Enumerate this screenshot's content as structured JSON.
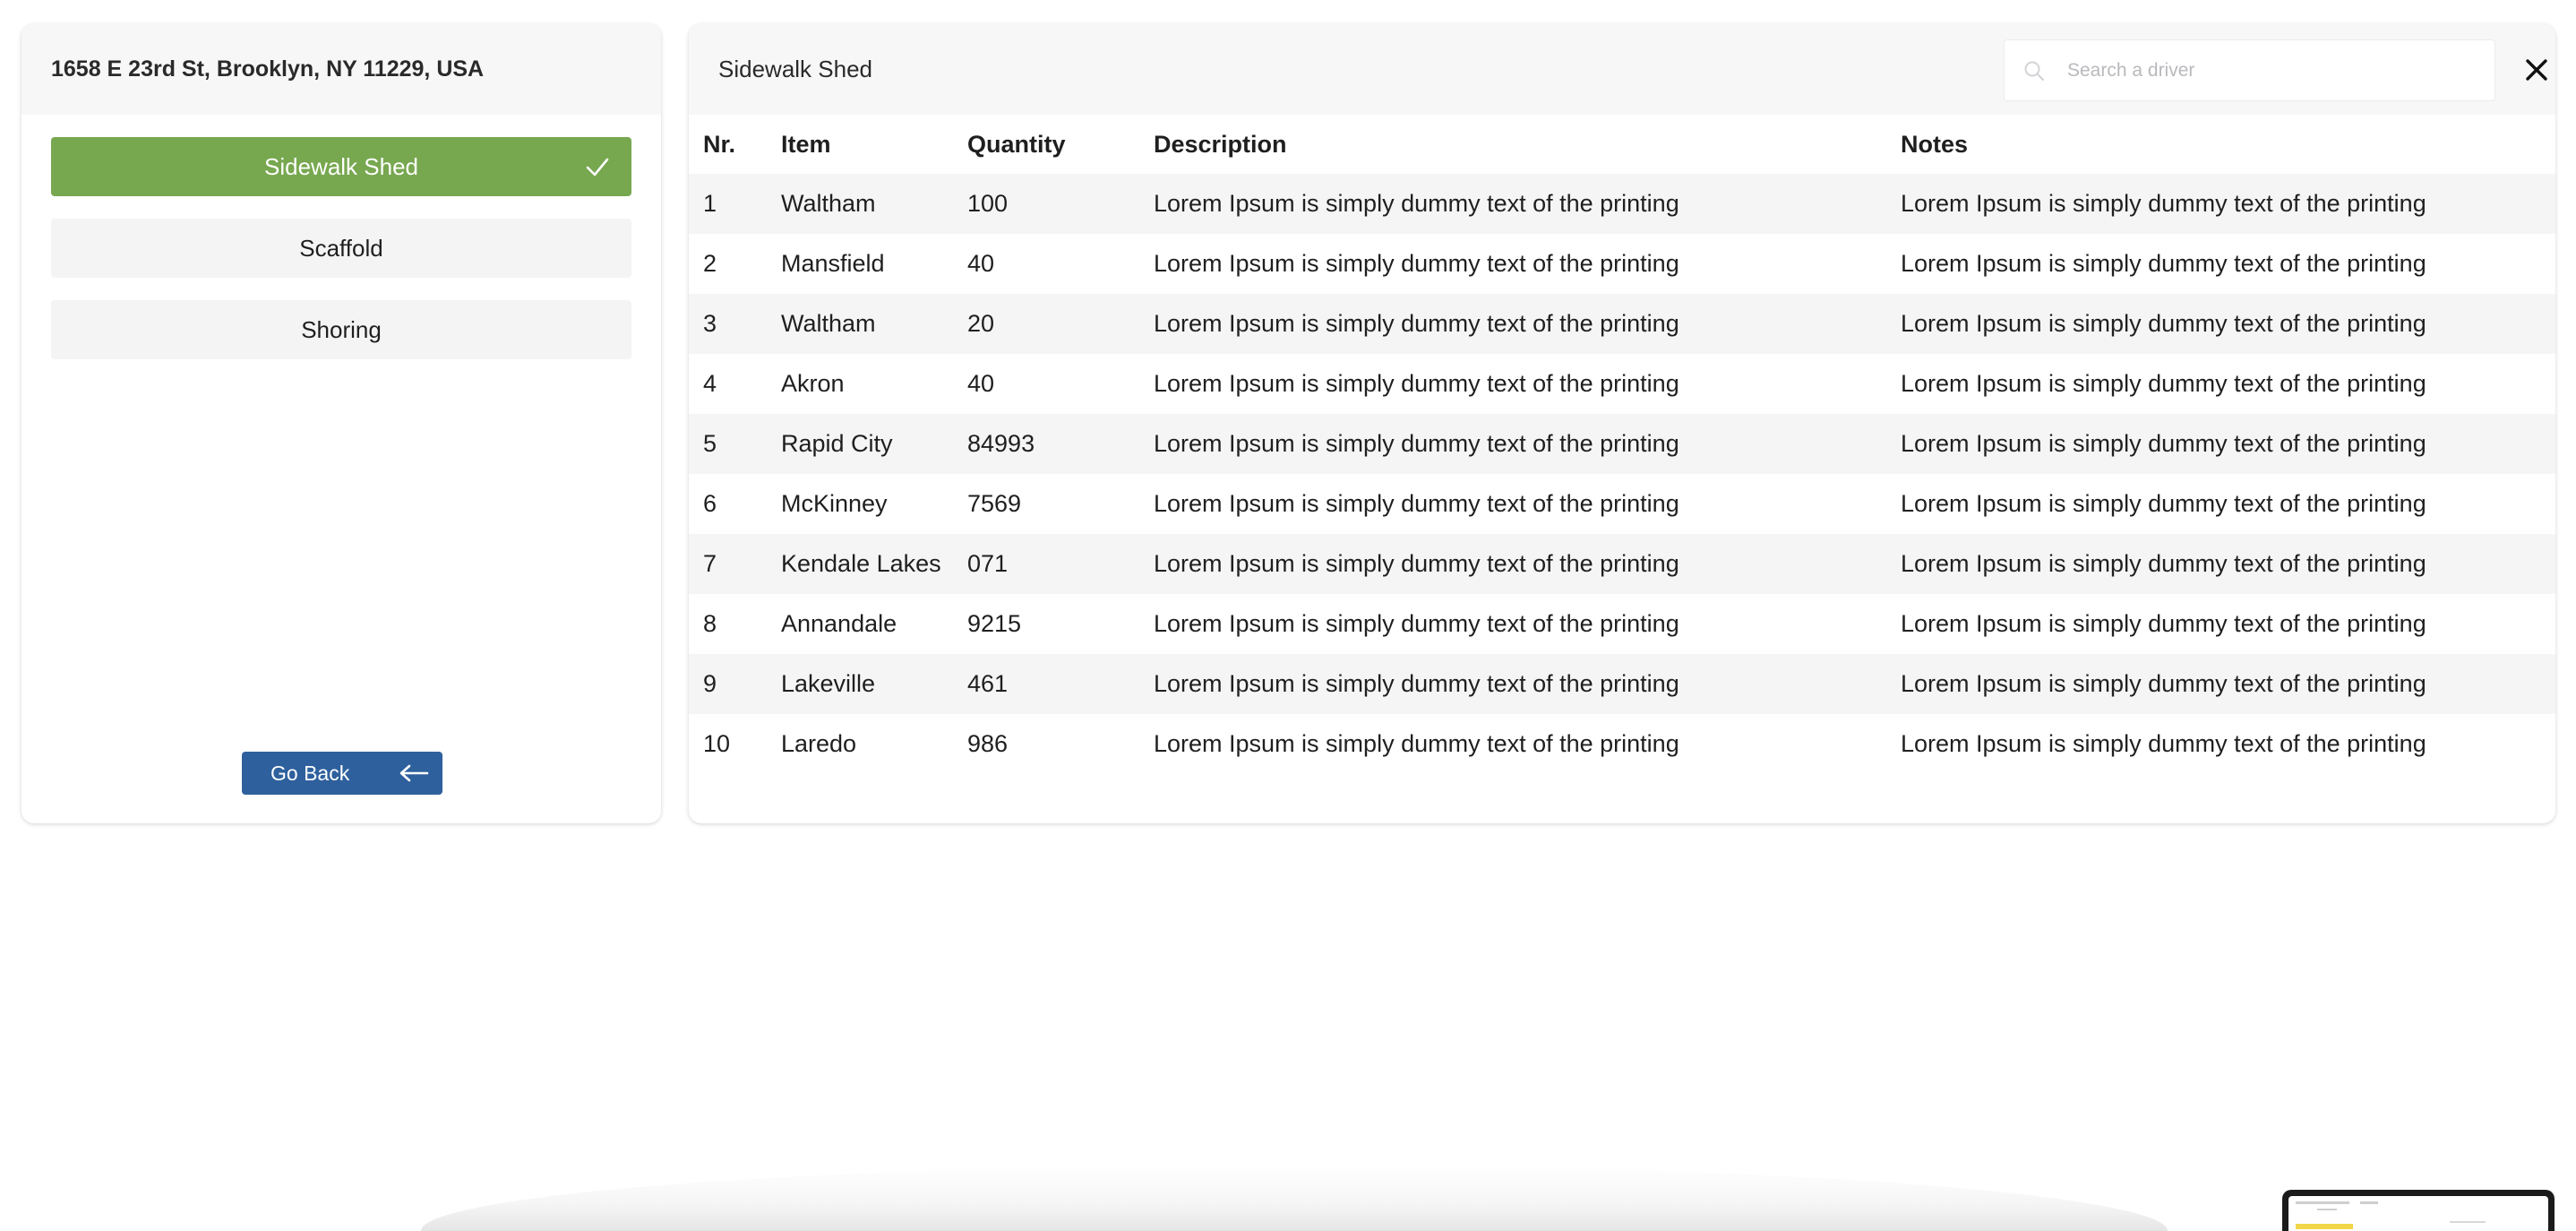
{
  "left_panel": {
    "address": "1658 E 23rd St, Brooklyn, NY 11229, USA",
    "options": [
      {
        "label": "Sidewalk Shed",
        "selected": true
      },
      {
        "label": "Scaffold",
        "selected": false
      },
      {
        "label": "Shoring",
        "selected": false
      }
    ],
    "go_back_label": "Go Back"
  },
  "right_panel": {
    "title": "Sidewalk Shed",
    "search_placeholder": "Search a driver",
    "table": {
      "headers": [
        "Nr.",
        "Item",
        "Quantity",
        "Description",
        "Notes"
      ],
      "rows": [
        [
          "1",
          "Waltham",
          "100",
          "Lorem Ipsum is simply dummy text of the printing",
          "Lorem Ipsum is simply dummy text of the printing"
        ],
        [
          "2",
          "Mansfield",
          "40",
          "Lorem Ipsum is simply dummy text of the printing",
          "Lorem Ipsum is simply dummy text of the printing"
        ],
        [
          "3",
          "Waltham",
          "20",
          "Lorem Ipsum is simply dummy text of the printing",
          "Lorem Ipsum is simply dummy text of the printing"
        ],
        [
          "4",
          "Akron",
          "40",
          "Lorem Ipsum is simply dummy text of the printing",
          "Lorem Ipsum is simply dummy text of the printing"
        ],
        [
          "5",
          "Rapid City",
          "84993",
          "Lorem Ipsum is simply dummy text of the printing",
          "Lorem Ipsum is simply dummy text of the printing"
        ],
        [
          "6",
          "McKinney",
          "7569",
          "Lorem Ipsum is simply dummy text of the printing",
          "Lorem Ipsum is simply dummy text of the printing"
        ],
        [
          "7",
          "Kendale Lakes",
          "071",
          "Lorem Ipsum is simply dummy text of the printing",
          "Lorem Ipsum is simply dummy text of the printing"
        ],
        [
          "8",
          "Annandale",
          "9215",
          "Lorem Ipsum is simply dummy text of the printing",
          "Lorem Ipsum is simply dummy text of the printing"
        ],
        [
          "9",
          "Lakeville",
          "461",
          "Lorem Ipsum is simply dummy text of the printing",
          "Lorem Ipsum is simply dummy text of the printing"
        ],
        [
          "10",
          "Laredo",
          "986",
          "Lorem Ipsum is simply dummy text of the printing",
          "Lorem Ipsum is simply dummy text of the printing"
        ]
      ]
    }
  },
  "icons": {
    "check": "check-icon",
    "arrow_left": "arrow-left-icon",
    "search": "search-icon",
    "close": "close-icon"
  },
  "colors": {
    "selected_option": "#77a74f",
    "go_back_button": "#2e609d",
    "panel_header": "#f7f7f8",
    "striped_row": "#f5f5f6"
  }
}
